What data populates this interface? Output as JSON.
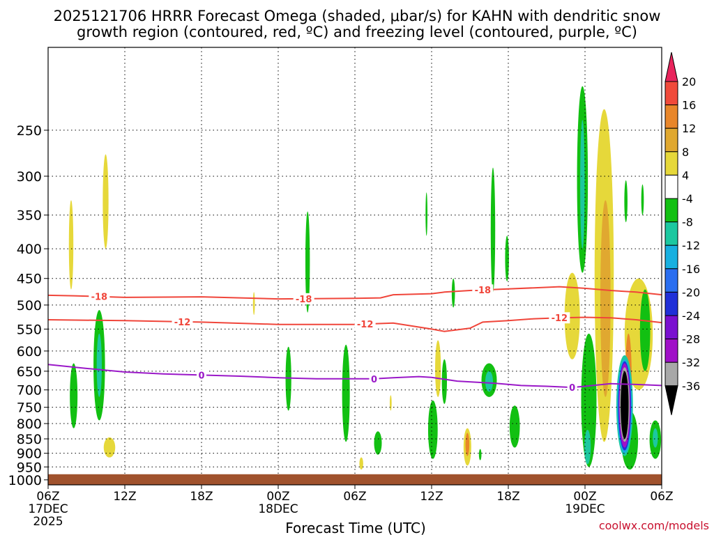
{
  "title_line1": "2025121706 HRRR Forecast Omega (shaded, μbar/s) for KAHN with dendritic snow",
  "title_line2": "growth region (contoured, red, ºC) and freezing level (contoured, purple, ºC)",
  "credit": "coolwx.com/models",
  "chart_data": {
    "type": "heatmap",
    "title": "2025121706 HRRR Forecast Omega (shaded, μbar/s) for KAHN with dendritic snow growth region (contoured, red, ºC) and freezing level (contoured, purple, ºC)",
    "xlabel": "Forecast Time (UTC)",
    "ylabel": "",
    "x_unit": "forecast hour from 2025-12-17 06Z",
    "xlim": [
      0,
      48
    ],
    "ylim": [
      1020,
      180
    ],
    "y_scale": "log-pressure, inverted",
    "grid": true,
    "x_ticks": [
      {
        "h": 0,
        "label": "06Z",
        "sub1": "17DEC",
        "sub2": "2025"
      },
      {
        "h": 6,
        "label": "12Z",
        "sub1": "",
        "sub2": ""
      },
      {
        "h": 12,
        "label": "18Z",
        "sub1": "",
        "sub2": ""
      },
      {
        "h": 18,
        "label": "00Z",
        "sub1": "18DEC",
        "sub2": ""
      },
      {
        "h": 24,
        "label": "06Z",
        "sub1": "",
        "sub2": ""
      },
      {
        "h": 30,
        "label": "12Z",
        "sub1": "",
        "sub2": ""
      },
      {
        "h": 36,
        "label": "18Z",
        "sub1": "",
        "sub2": ""
      },
      {
        "h": 42,
        "label": "00Z",
        "sub1": "19DEC",
        "sub2": ""
      },
      {
        "h": 48,
        "label": "06Z",
        "sub1": "",
        "sub2": ""
      }
    ],
    "y_ticks": [
      250,
      300,
      350,
      400,
      450,
      500,
      550,
      600,
      650,
      700,
      750,
      800,
      850,
      900,
      950,
      1000
    ],
    "colorbar": {
      "levels": [
        20,
        16,
        12,
        8,
        4,
        -4,
        -8,
        -12,
        -16,
        -20,
        -24,
        -28,
        -32,
        -36
      ],
      "colors": [
        "#e8245c",
        "#f04a3a",
        "#e8862a",
        "#e0a830",
        "#e6d83a",
        "#ffffff",
        "#12c012",
        "#1cc8a0",
        "#18b0e0",
        "#2a6ef0",
        "#2030d8",
        "#7a10d0",
        "#a010c8",
        "#a8a8a8",
        "#000000"
      ]
    },
    "contours": [
      {
        "name": "-18",
        "color": "#f0453a",
        "label_hours": [
          4,
          20,
          34
        ],
        "points": [
          [
            0,
            481
          ],
          [
            2,
            482
          ],
          [
            6,
            485
          ],
          [
            12,
            484
          ],
          [
            18,
            488
          ],
          [
            24,
            487
          ],
          [
            26,
            486
          ],
          [
            27,
            480
          ],
          [
            30,
            478
          ],
          [
            31,
            475
          ],
          [
            33,
            472
          ],
          [
            35,
            470
          ],
          [
            38,
            467
          ],
          [
            40,
            465
          ],
          [
            42,
            468
          ],
          [
            44,
            472
          ],
          [
            46,
            475
          ],
          [
            48,
            480
          ]
        ]
      },
      {
        "name": "-12",
        "color": "#f0453a",
        "label_hours": [
          10.5,
          24.8,
          40
        ],
        "points": [
          [
            0,
            530
          ],
          [
            6,
            532
          ],
          [
            12,
            535
          ],
          [
            18,
            540
          ],
          [
            24,
            540
          ],
          [
            27,
            537
          ],
          [
            30,
            550
          ],
          [
            31,
            555
          ],
          [
            33,
            548
          ],
          [
            34,
            535
          ],
          [
            36,
            532
          ],
          [
            38,
            528
          ],
          [
            40,
            526
          ],
          [
            42,
            525
          ],
          [
            44,
            526
          ],
          [
            46,
            530
          ],
          [
            48,
            536
          ]
        ]
      },
      {
        "name": "0",
        "color": "#9a18c8",
        "label_hours": [
          12,
          25.5,
          41
        ],
        "points": [
          [
            0,
            633
          ],
          [
            3,
            643
          ],
          [
            6,
            652
          ],
          [
            9,
            657
          ],
          [
            12,
            660
          ],
          [
            15,
            663
          ],
          [
            18,
            667
          ],
          [
            21,
            670
          ],
          [
            24,
            670
          ],
          [
            25.5,
            670
          ],
          [
            27,
            667
          ],
          [
            29,
            664
          ],
          [
            30,
            666
          ],
          [
            32,
            676
          ],
          [
            35,
            682
          ],
          [
            37,
            688
          ],
          [
            39,
            690
          ],
          [
            41,
            693
          ],
          [
            42,
            690
          ],
          [
            44,
            683
          ],
          [
            46,
            685
          ],
          [
            48,
            688
          ]
        ]
      }
    ],
    "omega_cells": [
      {
        "h": 1.8,
        "p0": 330,
        "p1": 470,
        "w": 0.35,
        "v": 5
      },
      {
        "h": 4.5,
        "p0": 275,
        "p1": 400,
        "w": 0.45,
        "v": 5
      },
      {
        "h": 16.1,
        "p0": 475,
        "p1": 520,
        "w": 0.15,
        "v": 5
      },
      {
        "h": 4.8,
        "p0": 845,
        "p1": 915,
        "w": 0.9,
        "v": 5
      },
      {
        "h": 2,
        "p0": 630,
        "p1": 815,
        "w": 0.6,
        "v": -6
      },
      {
        "h": 4,
        "p0": 510,
        "p1": 790,
        "w": 0.9,
        "v": -6
      },
      {
        "h": 4,
        "p0": 560,
        "p1": 720,
        "w": 0.4,
        "v": -9
      },
      {
        "h": 20.3,
        "p0": 345,
        "p1": 515,
        "w": 0.35,
        "v": -6
      },
      {
        "h": 18.8,
        "p0": 590,
        "p1": 760,
        "w": 0.45,
        "v": -6
      },
      {
        "h": 23.3,
        "p0": 585,
        "p1": 860,
        "w": 0.6,
        "v": -6
      },
      {
        "h": 25.8,
        "p0": 825,
        "p1": 905,
        "w": 0.6,
        "v": -6
      },
      {
        "h": 26.8,
        "p0": 715,
        "p1": 760,
        "w": 0.15,
        "v": 5
      },
      {
        "h": 24.5,
        "p0": 915,
        "p1": 960,
        "w": 0.3,
        "v": 5
      },
      {
        "h": 29.6,
        "p0": 320,
        "p1": 380,
        "w": 0.15,
        "v": -6
      },
      {
        "h": 30.5,
        "p0": 575,
        "p1": 720,
        "w": 0.45,
        "v": 5
      },
      {
        "h": 30.1,
        "p0": 730,
        "p1": 920,
        "w": 0.75,
        "v": -6
      },
      {
        "h": 31,
        "p0": 620,
        "p1": 740,
        "w": 0.4,
        "v": -6
      },
      {
        "h": 31.7,
        "p0": 450,
        "p1": 505,
        "w": 0.25,
        "v": -6
      },
      {
        "h": 32.8,
        "p0": 815,
        "p1": 945,
        "w": 0.6,
        "v": 5
      },
      {
        "h": 32.8,
        "p0": 830,
        "p1": 910,
        "w": 0.3,
        "v": 14
      },
      {
        "h": 34.5,
        "p0": 630,
        "p1": 720,
        "w": 1.2,
        "v": -6
      },
      {
        "h": 34.5,
        "p0": 650,
        "p1": 705,
        "w": 0.6,
        "v": -10
      },
      {
        "h": 34.8,
        "p0": 290,
        "p1": 475,
        "w": 0.35,
        "v": -6
      },
      {
        "h": 35.9,
        "p0": 380,
        "p1": 455,
        "w": 0.3,
        "v": -6
      },
      {
        "h": 36.5,
        "p0": 745,
        "p1": 880,
        "w": 0.8,
        "v": -6
      },
      {
        "h": 33.8,
        "p0": 885,
        "p1": 925,
        "w": 0.2,
        "v": -6
      },
      {
        "h": 41.8,
        "p0": 210,
        "p1": 440,
        "w": 0.85,
        "v": -6
      },
      {
        "h": 41.8,
        "p0": 240,
        "p1": 400,
        "w": 0.35,
        "v": -10
      },
      {
        "h": 42.3,
        "p0": 560,
        "p1": 950,
        "w": 1.2,
        "v": -6
      },
      {
        "h": 42.2,
        "p0": 820,
        "p1": 940,
        "w": 0.5,
        "v": -10
      },
      {
        "h": 43.5,
        "p0": 230,
        "p1": 860,
        "w": 1.5,
        "v": 5
      },
      {
        "h": 43.6,
        "p0": 330,
        "p1": 720,
        "w": 0.8,
        "v": 9
      },
      {
        "h": 41,
        "p0": 440,
        "p1": 620,
        "w": 1.2,
        "v": 5
      },
      {
        "h": 46.2,
        "p0": 450,
        "p1": 700,
        "w": 2.2,
        "v": 5
      },
      {
        "h": 46.7,
        "p0": 470,
        "p1": 650,
        "w": 0.8,
        "v": -6
      },
      {
        "h": 45.5,
        "p0": 760,
        "p1": 960,
        "w": 1.3,
        "v": -6
      },
      {
        "h": 47.5,
        "p0": 790,
        "p1": 920,
        "w": 0.9,
        "v": -6
      },
      {
        "h": 47.5,
        "p0": 815,
        "p1": 880,
        "w": 0.4,
        "v": -10
      },
      {
        "h": 45.2,
        "p0": 305,
        "p1": 360,
        "w": 0.25,
        "v": -6
      },
      {
        "h": 46.5,
        "p0": 310,
        "p1": 350,
        "w": 0.2,
        "v": -6
      },
      {
        "h": 45.4,
        "p0": 560,
        "p1": 800,
        "w": 0.5,
        "v": 14
      },
      {
        "h": 45.1,
        "p0": 610,
        "p1": 910,
        "w": 1.3,
        "v": -10
      },
      {
        "h": 45.1,
        "p0": 620,
        "p1": 900,
        "w": 1.15,
        "v": -14
      },
      {
        "h": 45.1,
        "p0": 625,
        "p1": 890,
        "w": 1.02,
        "v": -21
      },
      {
        "h": 45.1,
        "p0": 630,
        "p1": 880,
        "w": 0.9,
        "v": -29
      },
      {
        "h": 45.1,
        "p0": 640,
        "p1": 860,
        "w": 0.78,
        "v": -33
      },
      {
        "h": 45.1,
        "p0": 650,
        "p1": 850,
        "w": 0.62,
        "v": -40
      }
    ],
    "surface": {
      "color": "#a0522d",
      "p_top": 978
    }
  }
}
